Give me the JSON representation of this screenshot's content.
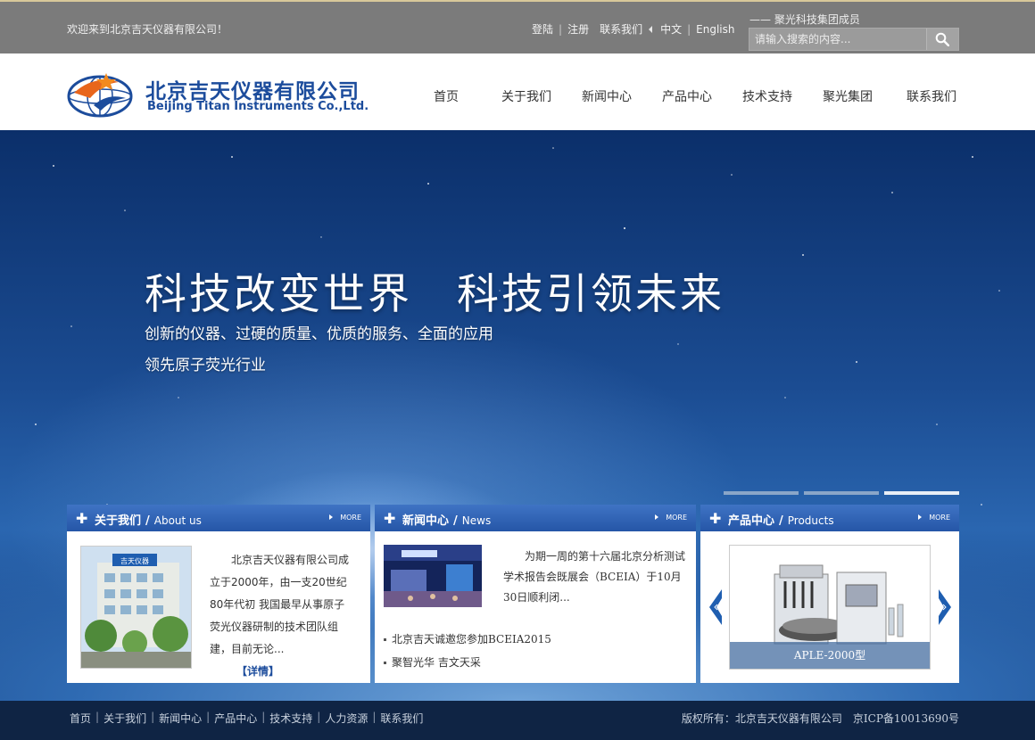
{
  "topbar": {
    "welcome": "欢迎来到北京吉天仪器有限公司！",
    "links": [
      "登陆",
      "注册",
      "联系我们",
      "中文",
      "English"
    ],
    "member": "—— 聚光科技集团成员",
    "search_placeholder": "请输入搜索的内容..."
  },
  "header": {
    "logo_cn": "北京吉天仪器有限公司",
    "logo_en": "Beijing Titan Instruments Co.,Ltd.",
    "nav": [
      "首页",
      "关于我们",
      "新闻中心",
      "产品中心",
      "技术支持",
      "聚光集团",
      "联系我们"
    ]
  },
  "banner": {
    "slogan": "科技改变世界　科技引领未来",
    "sub1": "创新的仪器、过硬的质量、优质的服务、全面的应用",
    "sub2": "领先原子荧光行业",
    "active_slide": 3,
    "slide_count": 3
  },
  "panels": {
    "about": {
      "title_cn": "关于我们",
      "title_en": "About us",
      "more": "MORE",
      "text": "北京吉天仪器有限公司成立于2000年，由一支20世纪80年代初 我国最早从事原子荧光仪器研制的技术团队组建，目前无论...",
      "detail": "【详情】",
      "building_sign": "吉天仪器"
    },
    "news": {
      "title_cn": "新闻中心",
      "title_en": "News",
      "more": "MORE",
      "summary": "为期一周的第十六届北京分析测试学术报告会既展会（BCEIA）于10月30日顺利闭...",
      "items": [
        "北京吉天诚邀您参加BCEIA2015",
        "聚智光华 吉文天采"
      ]
    },
    "products": {
      "title_cn": "产品中心",
      "title_en": "Products",
      "more": "MORE",
      "caption": "APLE-2000型"
    }
  },
  "footer": {
    "links": [
      "首页",
      "关于我们",
      "新闻中心",
      "产品中心",
      "技术支持",
      "人力资源",
      "联系我们"
    ],
    "copyright": "版权所有：北京吉天仪器有限公司",
    "icp": "京ICP备10013690号"
  },
  "colors": {
    "brand_blue": "#1c4c9c",
    "topbar_gray": "#7b7b7b",
    "panel_head": "#2f63b5",
    "footer_bg": "#0f2444"
  }
}
